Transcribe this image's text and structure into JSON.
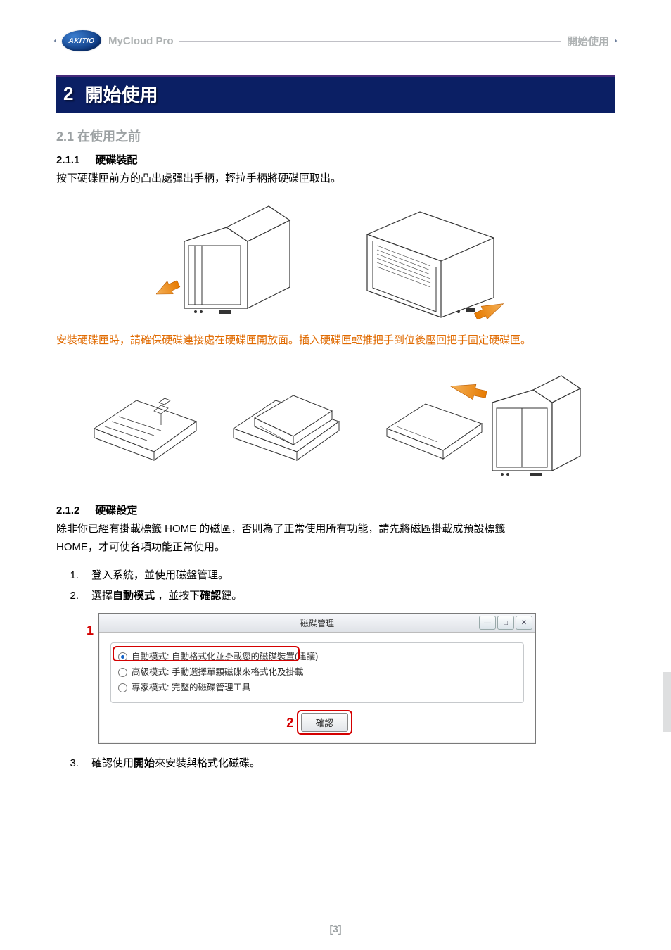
{
  "header": {
    "brand": "AKITIO",
    "product": "MyCloud Pro",
    "right": "開始使用"
  },
  "chapter": {
    "number": "2",
    "title": "開始使用"
  },
  "sec21": {
    "label": "2.1   在使用之前"
  },
  "sec211": {
    "number": "2.1.1",
    "title": "硬碟裝配",
    "p1": "按下硬碟匣前方的凸出處彈出手柄，輕拉手柄將硬碟匣取出。",
    "p2": "安裝硬碟匣時，請確保硬碟連接處在硬碟匣開放面。插入硬碟匣輕推把手到位後壓回把手固定硬碟匣。"
  },
  "sec212": {
    "number": "2.1.2",
    "title": "硬碟設定",
    "p1a": "除非你已經有掛載標籤 HOME 的磁區，否則為了正常使用所有功能，請先將磁區掛載成預設標籤",
    "p1b": "HOME，才可使各項功能正常使用。",
    "steps": {
      "1": {
        "n": "1.",
        "t": "登入系統，並使用磁盤管理。"
      },
      "2": {
        "n": "2.",
        "t_pre": "選擇",
        "t_bold1": "自動模式",
        "t_mid": "   ，並按下",
        "t_bold2": "確認",
        "t_post": "鍵。"
      },
      "3": {
        "n": "3.",
        "t_pre": "確認使用",
        "t_bold": "開始",
        "t_post": "來安裝與格式化磁碟。"
      }
    }
  },
  "dialog": {
    "title": "磁碟管理",
    "win": {
      "min": "—",
      "max": "□",
      "close": "✕"
    },
    "modes": {
      "auto": "自動模式: 自動格式化並掛載您的磁碟裝置(建議)",
      "adv": "高級模式: 手動選擇單顆磁碟來格式化及掛載",
      "expert": "專家模式: 完整的磁碟管理工具"
    },
    "confirm": "確認",
    "callouts": {
      "one": "1",
      "two": "2"
    }
  },
  "footer": {
    "page": "[3]"
  }
}
